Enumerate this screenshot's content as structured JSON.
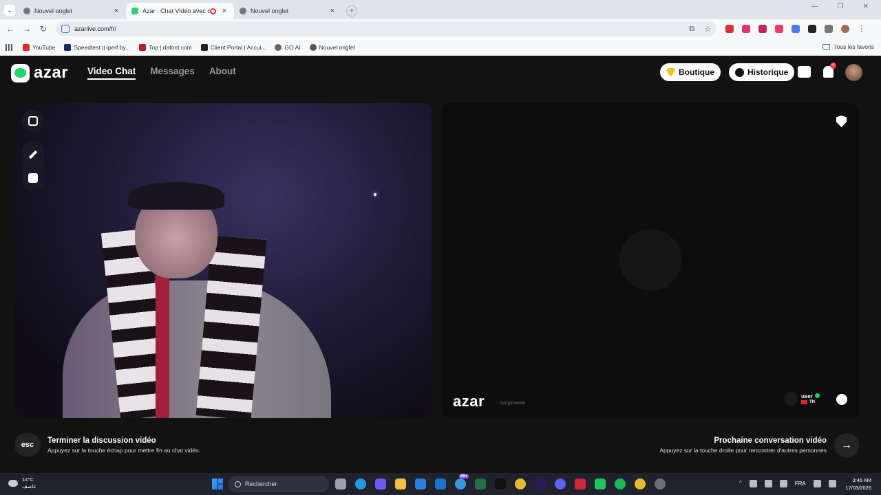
{
  "browser": {
    "tabs": [
      {
        "title": "Nouvel onglet",
        "active": false
      },
      {
        "title": "Azar : Chat Vidéo avec de n",
        "active": true
      },
      {
        "title": "Nouvel onglet",
        "active": false
      }
    ],
    "url": "azarlive.com/fr/",
    "bookmarks": [
      "YouTube",
      "Speedtest || iperf by...",
      "Top | dafont.com",
      "Client Portal | Accui...",
      "GO AI",
      "Nouvel onglet"
    ],
    "all_bookmarks": "Tous les favoris"
  },
  "site": {
    "logo": "azar",
    "nav": [
      "Video Chat",
      "Messages",
      "About"
    ],
    "shop_label": "Boutique",
    "history_label": "Historique",
    "notification_count": "4",
    "remote": {
      "logo": "azar",
      "id": "huCgZvoxNw",
      "username": "user",
      "country": "TN"
    },
    "end_key": "esc",
    "end_title": "Terminer la discussion vidéo",
    "end_subtitle": "Appuyez sur la touche échap pour mettre fin au chat vidéo.",
    "next_title": "Prochaine conversation vidéo",
    "next_subtitle": "Appuyez sur la touche droite pour rencontrer d'autres personnes",
    "next_icon": "→"
  },
  "taskbar": {
    "temp": "14°C",
    "weather_text": "عاصف",
    "search_label": "Rechercher",
    "language": "FRA",
    "time": "3:46 AM",
    "date": "17/03/2026",
    "app_badge": "99+"
  }
}
